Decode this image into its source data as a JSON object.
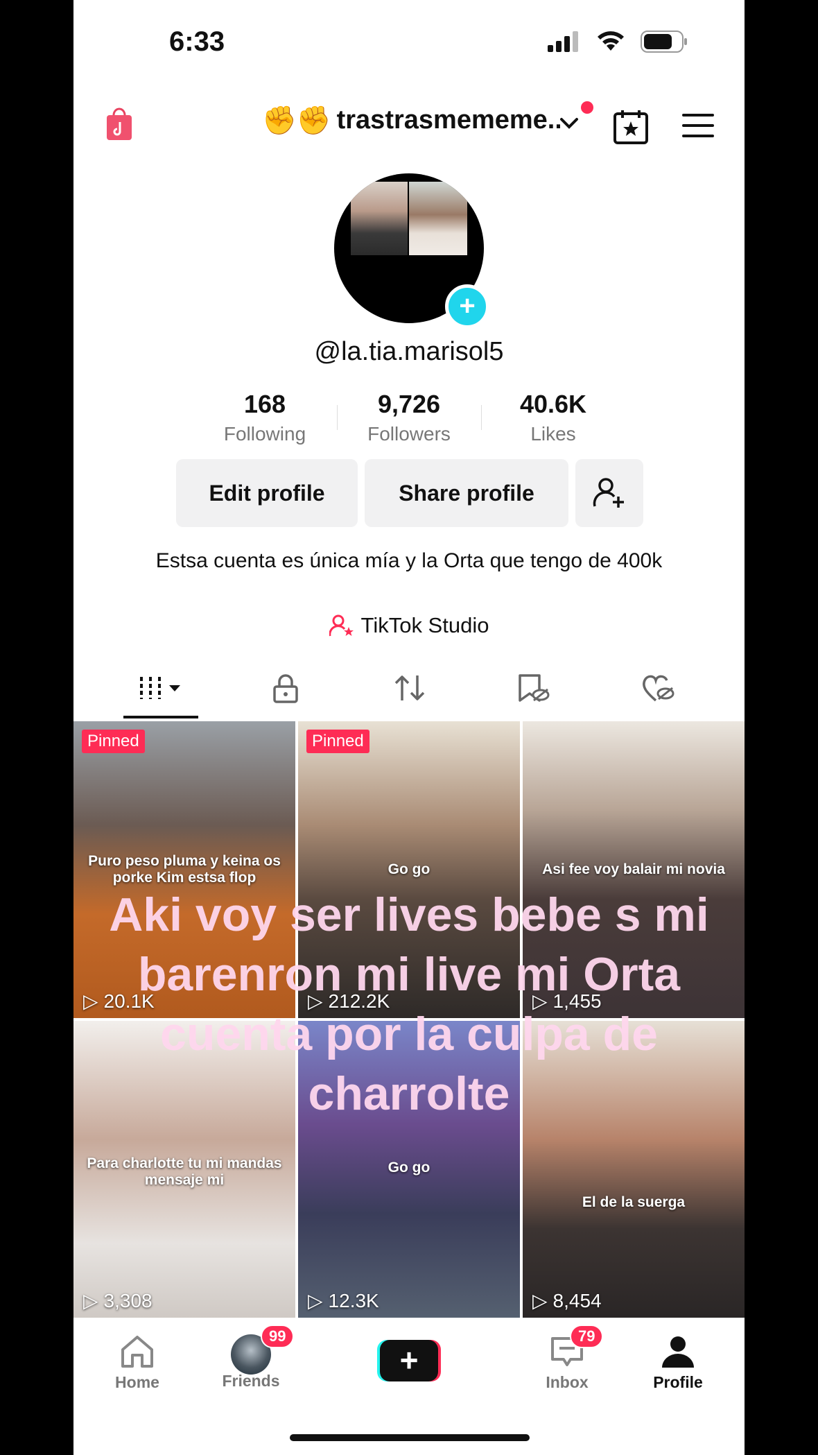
{
  "status_bar": {
    "time": "6:33"
  },
  "header": {
    "title_emoji": "✊✊",
    "title": "trastrasmememe..."
  },
  "profile": {
    "username": "@la.tia.marisol5",
    "stats": [
      {
        "value": "168",
        "label": "Following"
      },
      {
        "value": "9,726",
        "label": "Followers"
      },
      {
        "value": "40.6K",
        "label": "Likes"
      }
    ],
    "edit_button": "Edit profile",
    "share_button": "Share profile",
    "bio": "Estsa cuenta es única mía y la Orta que tengo de 400k",
    "studio_link": "TikTok Studio"
  },
  "tabs": [
    "videos-grid-icon",
    "lock-icon",
    "repost-icon",
    "saved-hidden-icon",
    "liked-hidden-icon"
  ],
  "videos": [
    {
      "pinned_label": "Pinned",
      "caption": "Puro peso pluma y keina os porke Kim estsa flop",
      "views": "20.1K",
      "bg": "linear-gradient(180deg,#9aa0a6 0%,#6b5b53 35%,#c46a2a 65%,#b15a1e 100%)"
    },
    {
      "pinned_label": "Pinned",
      "caption": "Go go",
      "views": "212.2K",
      "bg": "linear-gradient(180deg,#e8e1d4 0%,#a98b74 35%,#5a4a40 60%,#2e2a28 100%)"
    },
    {
      "pinned_label": "",
      "caption": "Asi fee voy balair mi novia",
      "views": "1,455",
      "bg": "linear-gradient(180deg,#ece7e0 0%,#b8a596 30%,#4a3c3a 60%,#3d3336 100%)"
    },
    {
      "pinned_label": "",
      "caption": "Para charlotte tu mi mandas mensaje mi",
      "views": "3,308",
      "bg": "linear-gradient(180deg,#f2efec 0%,#c7a99a 40%,#e7e3e0 75%,#cfc9c4 100%)"
    },
    {
      "pinned_label": "",
      "caption": "Go go",
      "views": "12.3K",
      "bg": "linear-gradient(180deg,#7a86c9 0%,#6a4c8e 35%,#3a3d5a 65%,#556070 100%)"
    },
    {
      "pinned_label": "",
      "caption": "El de la suerga",
      "views": "8,454",
      "bg": "linear-gradient(180deg,#e6e0d6 0%,#b7836a 40%,#3c3432 70%,#2a2626 100%)"
    }
  ],
  "overlay_text": "Aki voy ser lives bebe s mi barenron mi live mi Orta cuenta por la culpa de charrolte",
  "nav": {
    "home": "Home",
    "friends": "Friends",
    "friends_badge": "99",
    "inbox": "Inbox",
    "inbox_badge": "79",
    "profile": "Profile"
  }
}
